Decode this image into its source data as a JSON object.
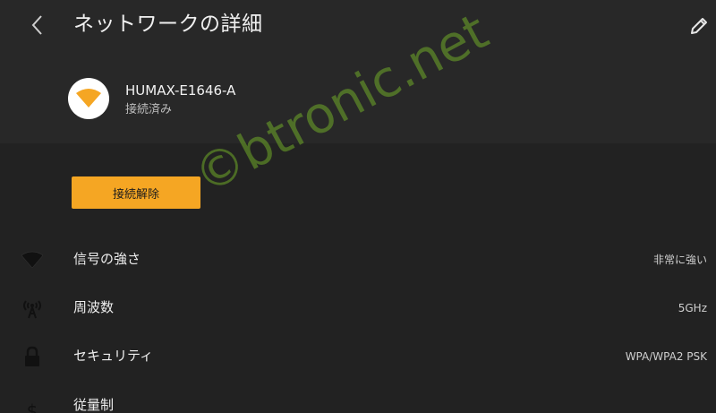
{
  "header": {
    "title": "ネットワークの詳細",
    "back_icon": "chevron-left-icon",
    "edit_icon": "pencil-icon"
  },
  "network": {
    "name": "HUMAX-E1646-A",
    "status": "接続済み",
    "icon": "wifi-icon"
  },
  "actions": {
    "disconnect_label": "接続解除"
  },
  "details": [
    {
      "label": "信号の強さ",
      "value": "非常に強い",
      "icon": "wifi-signal-icon"
    },
    {
      "label": "周波数",
      "value": "5GHz",
      "icon": "antenna-icon"
    },
    {
      "label": "セキュリティ",
      "value": "WPA/WPA2 PSK",
      "icon": "lock-icon"
    },
    {
      "label": "従量制",
      "value": "",
      "icon": "dollar-icon"
    }
  ],
  "watermark": "©btronic.net",
  "colors": {
    "accent": "#f5a623",
    "background": "#222222",
    "card": "#282828"
  }
}
